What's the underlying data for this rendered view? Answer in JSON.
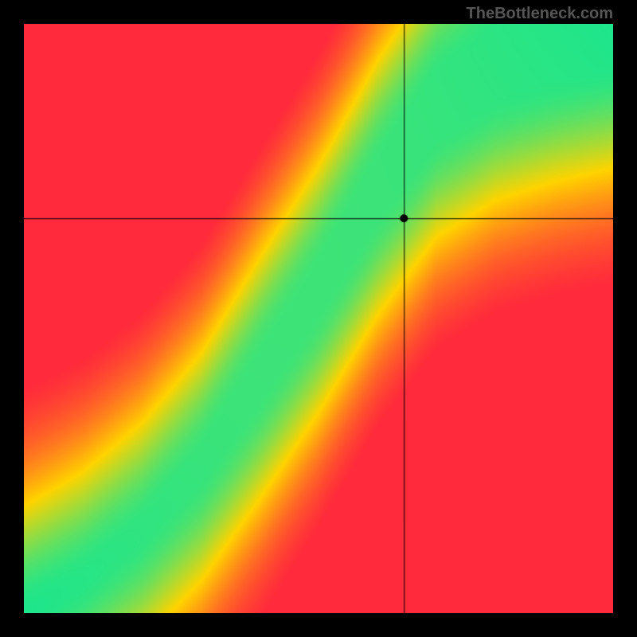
{
  "watermark": "TheBottleneck.com",
  "chart_data": {
    "type": "heatmap",
    "title": "",
    "xlabel": "",
    "ylabel": "",
    "xlim": [
      0,
      1
    ],
    "ylim": [
      0,
      1
    ],
    "crosshair": {
      "x": 0.645,
      "y": 0.67
    },
    "marker": {
      "x": 0.645,
      "y": 0.67
    },
    "ridge": [
      {
        "x": 0.0,
        "y": 0.0
      },
      {
        "x": 0.1,
        "y": 0.06
      },
      {
        "x": 0.2,
        "y": 0.14
      },
      {
        "x": 0.3,
        "y": 0.25
      },
      {
        "x": 0.4,
        "y": 0.4
      },
      {
        "x": 0.5,
        "y": 0.55
      },
      {
        "x": 0.6,
        "y": 0.72
      },
      {
        "x": 0.7,
        "y": 0.86
      },
      {
        "x": 0.8,
        "y": 0.93
      },
      {
        "x": 0.9,
        "y": 0.97
      },
      {
        "x": 1.0,
        "y": 1.0
      }
    ],
    "colorscale": {
      "low": "#ff2a3c",
      "mid": "#ffd400",
      "high": "#1ee68c"
    },
    "width_profile": {
      "start": 0.005,
      "mid": 0.08,
      "end": 0.15
    },
    "grid": false,
    "legend": false
  }
}
